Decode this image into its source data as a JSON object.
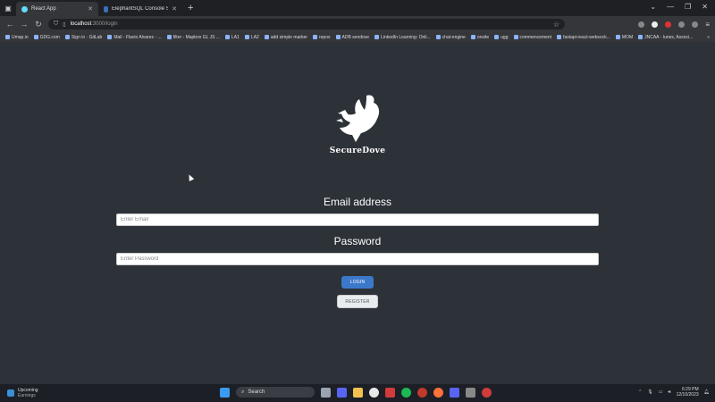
{
  "browser": {
    "tabs": [
      {
        "title": "React App",
        "active": true
      },
      {
        "title": "ElephantSQL Console SecureD...",
        "active": false
      }
    ],
    "new_tab": "+",
    "address": {
      "host": "localhost",
      "path": ":3000/login"
    },
    "bookmarks": [
      "Umap.in",
      "GDG.com",
      "Sign in · GitLab",
      "Mail - Flavio Alvarez - ...",
      "filter - Mapbox GL JS ...",
      "LA1",
      "LA2",
      "add simple marker",
      "repos",
      "ADB sendove",
      "LinkedIn Learning: Onli...",
      "chat-engine",
      "onsite",
      "ugg",
      "commencement",
      "fastapi-react-websock...",
      "MOM",
      "JNCAA - Iunes, Associ..."
    ]
  },
  "app": {
    "brand": "SecureDove",
    "email_label": "Email address",
    "email_placeholder": "Enter Email",
    "password_label": "Password",
    "password_placeholder": "Enter Password",
    "login_label": "LOGIN",
    "register_label": "REGISTER"
  },
  "taskbar": {
    "weather_title": "Upcoming",
    "weather_sub": "Earnings",
    "search_label": "Search",
    "time": "6:29 PM",
    "date": "12/10/2023"
  },
  "colors": {
    "page_bg": "#2d3138",
    "login_button": "#3b78c9",
    "register_button": "#e9ecef"
  }
}
